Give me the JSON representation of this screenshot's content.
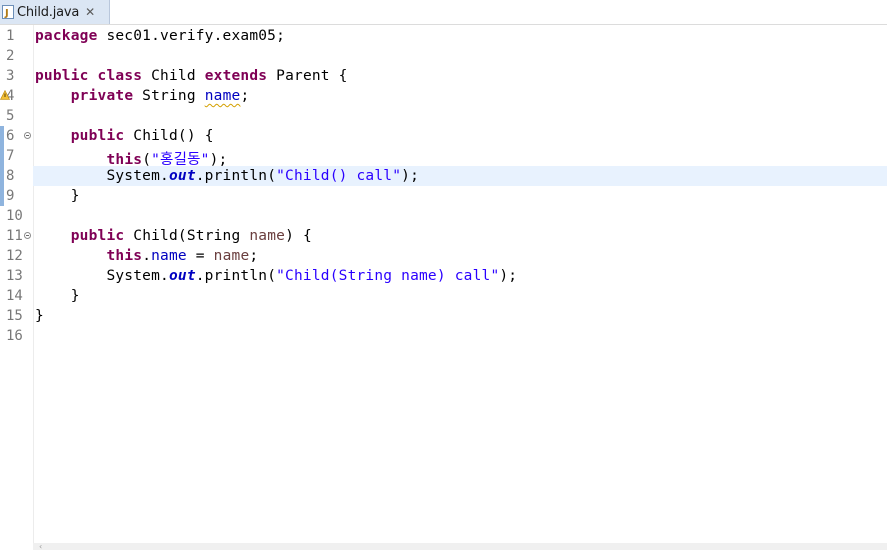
{
  "tab": {
    "label": "Child.java",
    "close": "✕"
  },
  "editor": {
    "current_line": 8,
    "lines": [
      {
        "n": "1",
        "tokens": [
          {
            "t": "package",
            "c": "kw"
          },
          {
            "t": " sec01.verify.exam05;",
            "c": ""
          }
        ]
      },
      {
        "n": "2",
        "tokens": []
      },
      {
        "n": "3",
        "tokens": [
          {
            "t": "public",
            "c": "kw"
          },
          {
            "t": " ",
            "c": ""
          },
          {
            "t": "class",
            "c": "kw"
          },
          {
            "t": " Child ",
            "c": ""
          },
          {
            "t": "extends",
            "c": "kw"
          },
          {
            "t": " Parent {",
            "c": ""
          }
        ]
      },
      {
        "n": "4",
        "tokens": [
          {
            "t": "    ",
            "c": ""
          },
          {
            "t": "private",
            "c": "kw"
          },
          {
            "t": " String ",
            "c": ""
          },
          {
            "t": "name",
            "c": "fld warn-underline"
          },
          {
            "t": ";",
            "c": ""
          }
        ]
      },
      {
        "n": "5",
        "tokens": []
      },
      {
        "n": "6",
        "tokens": [
          {
            "t": "    ",
            "c": ""
          },
          {
            "t": "public",
            "c": "kw"
          },
          {
            "t": " Child() {",
            "c": ""
          }
        ]
      },
      {
        "n": "7",
        "tokens": [
          {
            "t": "        ",
            "c": ""
          },
          {
            "t": "this",
            "c": "kw"
          },
          {
            "t": "(",
            "c": ""
          },
          {
            "t": "\"홍길동\"",
            "c": "str"
          },
          {
            "t": ");",
            "c": ""
          }
        ]
      },
      {
        "n": "8",
        "tokens": [
          {
            "t": "        System.",
            "c": ""
          },
          {
            "t": "out",
            "c": "sfld"
          },
          {
            "t": ".println(",
            "c": ""
          },
          {
            "t": "\"Child() call\"",
            "c": "str"
          },
          {
            "t": ");",
            "c": ""
          }
        ]
      },
      {
        "n": "9",
        "tokens": [
          {
            "t": "    }",
            "c": ""
          }
        ]
      },
      {
        "n": "10",
        "tokens": []
      },
      {
        "n": "11",
        "tokens": [
          {
            "t": "    ",
            "c": ""
          },
          {
            "t": "public",
            "c": "kw"
          },
          {
            "t": " Child(String ",
            "c": ""
          },
          {
            "t": "name",
            "c": "prm"
          },
          {
            "t": ") {",
            "c": ""
          }
        ]
      },
      {
        "n": "12",
        "tokens": [
          {
            "t": "        ",
            "c": ""
          },
          {
            "t": "this",
            "c": "kw"
          },
          {
            "t": ".",
            "c": ""
          },
          {
            "t": "name",
            "c": "fld"
          },
          {
            "t": " = ",
            "c": ""
          },
          {
            "t": "name",
            "c": "prm"
          },
          {
            "t": ";",
            "c": ""
          }
        ]
      },
      {
        "n": "13",
        "tokens": [
          {
            "t": "        System.",
            "c": ""
          },
          {
            "t": "out",
            "c": "sfld"
          },
          {
            "t": ".println(",
            "c": ""
          },
          {
            "t": "\"Child(String name) call\"",
            "c": "str"
          },
          {
            "t": ");",
            "c": ""
          }
        ]
      },
      {
        "n": "14",
        "tokens": [
          {
            "t": "    }",
            "c": ""
          }
        ]
      },
      {
        "n": "15",
        "tokens": [
          {
            "t": "}",
            "c": ""
          }
        ]
      },
      {
        "n": "16",
        "tokens": []
      }
    ],
    "fold_lines": [
      6,
      11
    ],
    "warning_lines": [
      4
    ]
  },
  "colors": {
    "keyword": "#7f0055",
    "string": "#2a00ff",
    "field": "#0000c0",
    "parameter": "#6a3e3e",
    "current_line_bg": "#e8f2fe",
    "tab_bg": "#dbe6f4"
  },
  "icons": {
    "tab": "java-file-icon",
    "warning": "warning-icon",
    "fold": "fold-collapse-icon"
  }
}
